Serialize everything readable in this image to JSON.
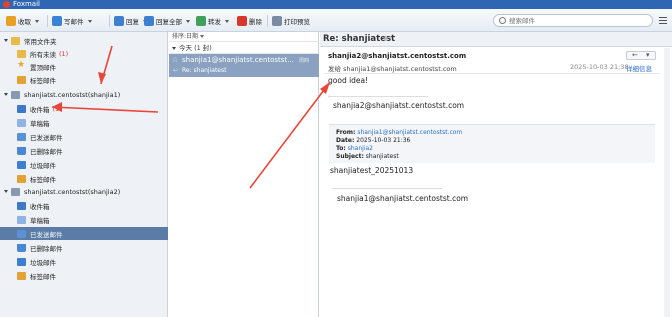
{
  "window": {
    "title": "Foxmail"
  },
  "toolbar": {
    "receive": "收取",
    "compose": "写邮件",
    "reply": "回复",
    "reply_all": "回复全部",
    "forward": "转发",
    "delete": "删除",
    "print_preview": "打印预览",
    "search_placeholder": "搜索邮件"
  },
  "sidebar": {
    "common": {
      "title": "常用文件夹",
      "items": [
        {
          "label": "所有未读",
          "badge": "(1)"
        },
        {
          "label": "置顶邮件"
        },
        {
          "label": "标签邮件"
        }
      ]
    },
    "account1": {
      "title": "shanjiatst.centostst(shanjia1)",
      "items": [
        {
          "label": "收件箱",
          "badge": "(1)"
        },
        {
          "label": "草稿箱"
        },
        {
          "label": "已发送邮件"
        },
        {
          "label": "已删除邮件"
        },
        {
          "label": "垃圾邮件"
        },
        {
          "label": "标签邮件"
        }
      ]
    },
    "account2": {
      "title": "shanjiatst.centostst(shanjia2)",
      "items": [
        {
          "label": "收件箱"
        },
        {
          "label": "草稿箱"
        },
        {
          "label": "已发送邮件"
        },
        {
          "label": "已删除邮件"
        },
        {
          "label": "垃圾邮件"
        },
        {
          "label": "标签邮件"
        }
      ]
    }
  },
  "message_list": {
    "sort_label": "排序:日期",
    "group_label": "今天 (1 封)",
    "message": {
      "sender": "shanjia1@shanjiatst.centostst...",
      "time": "周四",
      "subject": "Re: shanjiatest"
    }
  },
  "reader": {
    "subject": "Re: shanjiatest",
    "from": "shanjia2@shanjiatst.centostst.com",
    "to": "发给 shanjia1@shanjiatst.centostst.com",
    "date": "2025-10-03 21:38",
    "detail_link": "详细信息",
    "body": {
      "line1": "good idea!",
      "signature": "shanjia2@shanjiatst.centostst.com",
      "quote": {
        "from_label": "From:",
        "from_value": "shanjia1@shanjiatst.centostst.com",
        "date_label": "Date:",
        "date_value": "2025-10-03 21:36",
        "to_label": "To:",
        "to_value": "shanjia2",
        "subject_label": "Subject:",
        "subject_value": "shanjiatest"
      },
      "quoted_text": "shanjiatest_20251013",
      "quoted_signature": "shanjia1@shanjiatst.centostst.com"
    }
  },
  "colors": {
    "titlebar": "#2f66b3",
    "selection": "#5b7ca6",
    "message_selected": "#8aa2c0",
    "annotation_arrow": "#e8463b",
    "link": "#2a6fce",
    "badge": "#dd3333"
  }
}
